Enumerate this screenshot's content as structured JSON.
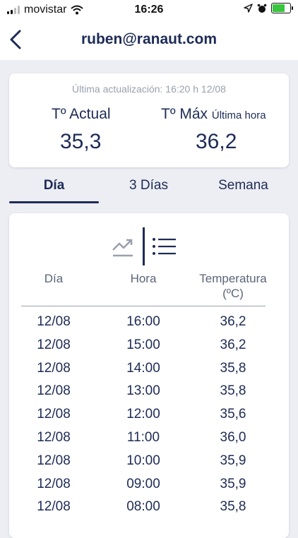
{
  "status_bar": {
    "carrier": "movistar",
    "time": "16:26",
    "battery_level": 0.64
  },
  "header": {
    "title": "ruben@ranaut.com"
  },
  "summary": {
    "last_update": "Última actualización: 16:20 h 12/08",
    "current_label": "Tº Actual",
    "current_value": "35,3",
    "max_label": "Tº Máx",
    "max_sublabel": "Última hora",
    "max_value": "36,2"
  },
  "tabs": [
    {
      "label": "Día",
      "active": true
    },
    {
      "label": "3 Días",
      "active": false
    },
    {
      "label": "Semana",
      "active": false
    }
  ],
  "table": {
    "headers": {
      "day": "Día",
      "hour": "Hora",
      "temperature_line1": "Temperatura",
      "temperature_line2": "(ºC)"
    },
    "rows": [
      {
        "day": "12/08",
        "hour": "16:00",
        "temp": "36,2"
      },
      {
        "day": "12/08",
        "hour": "15:00",
        "temp": "36,2"
      },
      {
        "day": "12/08",
        "hour": "14:00",
        "temp": "35,8"
      },
      {
        "day": "12/08",
        "hour": "13:00",
        "temp": "35,8"
      },
      {
        "day": "12/08",
        "hour": "12:00",
        "temp": "35,6"
      },
      {
        "day": "12/08",
        "hour": "11:00",
        "temp": "36,0"
      },
      {
        "day": "12/08",
        "hour": "10:00",
        "temp": "35,9"
      },
      {
        "day": "12/08",
        "hour": "09:00",
        "temp": "35,9"
      },
      {
        "day": "12/08",
        "hour": "08:00",
        "temp": "35,8"
      }
    ]
  },
  "icons": {
    "back": "chevron-left-icon",
    "chart_view": "trending-up-icon",
    "list_view": "list-icon"
  },
  "colors": {
    "primary": "#1d2b55",
    "muted": "#9aa0ad",
    "background": "#eceef3",
    "battery": "#3ac53e"
  }
}
